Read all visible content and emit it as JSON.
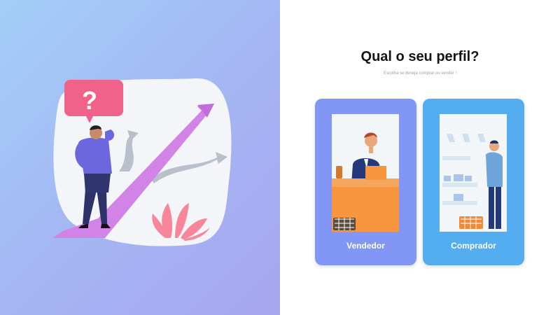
{
  "profile": {
    "title": "Qual o seu perfil?",
    "subtitle": "Escolha se deseja comprar ou vender !"
  },
  "cards": [
    {
      "label": "Vendedor",
      "icon": "shopkeeper-illustration",
      "color": "#8196f5"
    },
    {
      "label": "Comprador",
      "icon": "shopper-illustration",
      "color": "#53adef"
    }
  ],
  "hero": {
    "icon": "question-mark-icon",
    "question_mark": "?"
  },
  "colors": {
    "left_gradient_start": "#a3cff9",
    "left_gradient_end": "#a7a6ef",
    "arrow": "#d183e6",
    "question_bubble": "#f1628a",
    "counter": "#f7963f"
  }
}
